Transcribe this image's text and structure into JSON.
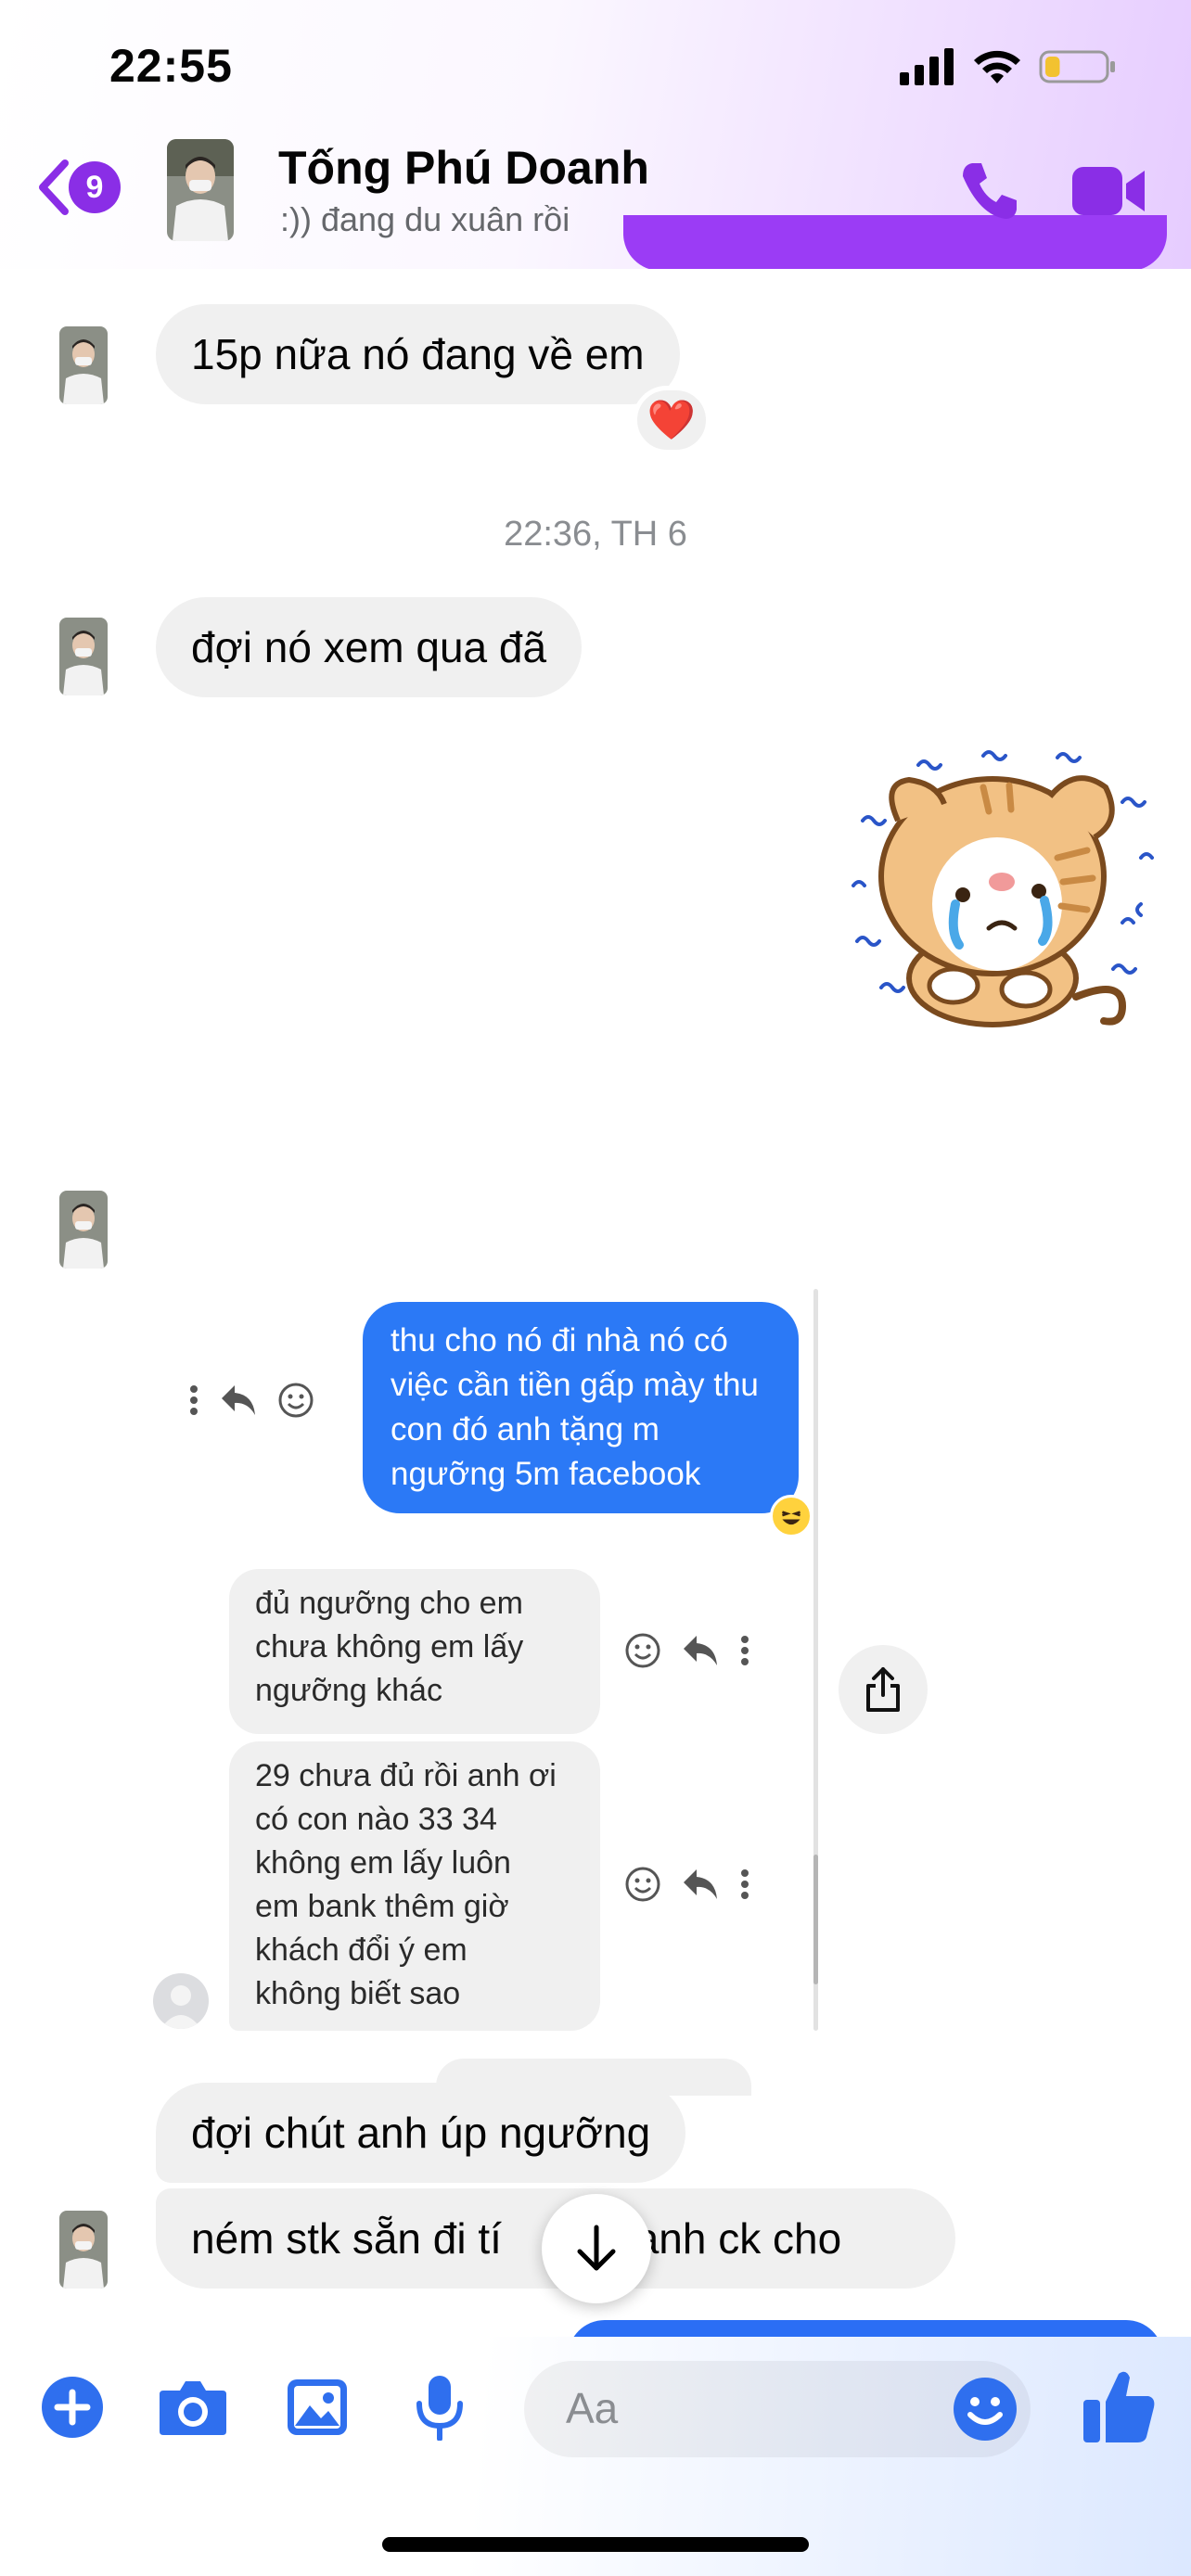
{
  "status_bar": {
    "time": "22:55",
    "battery_level": 0.25
  },
  "header": {
    "unread_count": "9",
    "contact_name": "Tống Phú Doanh",
    "contact_status": ":)) đang du xuân rồi"
  },
  "messages": {
    "m1": {
      "text": "15p nữa nó đang về em",
      "reaction": "❤️"
    },
    "timestamp": "22:36, TH 6",
    "m2": {
      "text": "đợi nó xem qua đã"
    },
    "m3": {
      "text": "đợi chút anh úp ngưỡng"
    },
    "m4": {
      "text": "ném stk sẵn đi tí",
      "text_end": "c anh ck cho"
    }
  },
  "embedded_screenshot": {
    "blue_message": [
      "thu cho nó đi nhà nó có",
      "việc cần tiền gấp mày thu",
      "con đó anh tặng m",
      "ngưỡng 5m facebook"
    ],
    "gray_message_1": [
      "đủ ngưỡng cho em",
      "chưa không em lấy",
      "ngưỡng khác"
    ],
    "gray_message_2": [
      "29 chưa đủ rồi anh ơi",
      "có con nào 33 34",
      "không em lấy luôn",
      "em bank thêm giờ",
      "khách đổi ý em",
      "không biết sao"
    ]
  },
  "composer": {
    "placeholder": "Aa"
  },
  "colors": {
    "accent_purple": "#8a2ee6",
    "messenger_blue": "#2b79f6",
    "icon_blue": "#2f6fee"
  }
}
